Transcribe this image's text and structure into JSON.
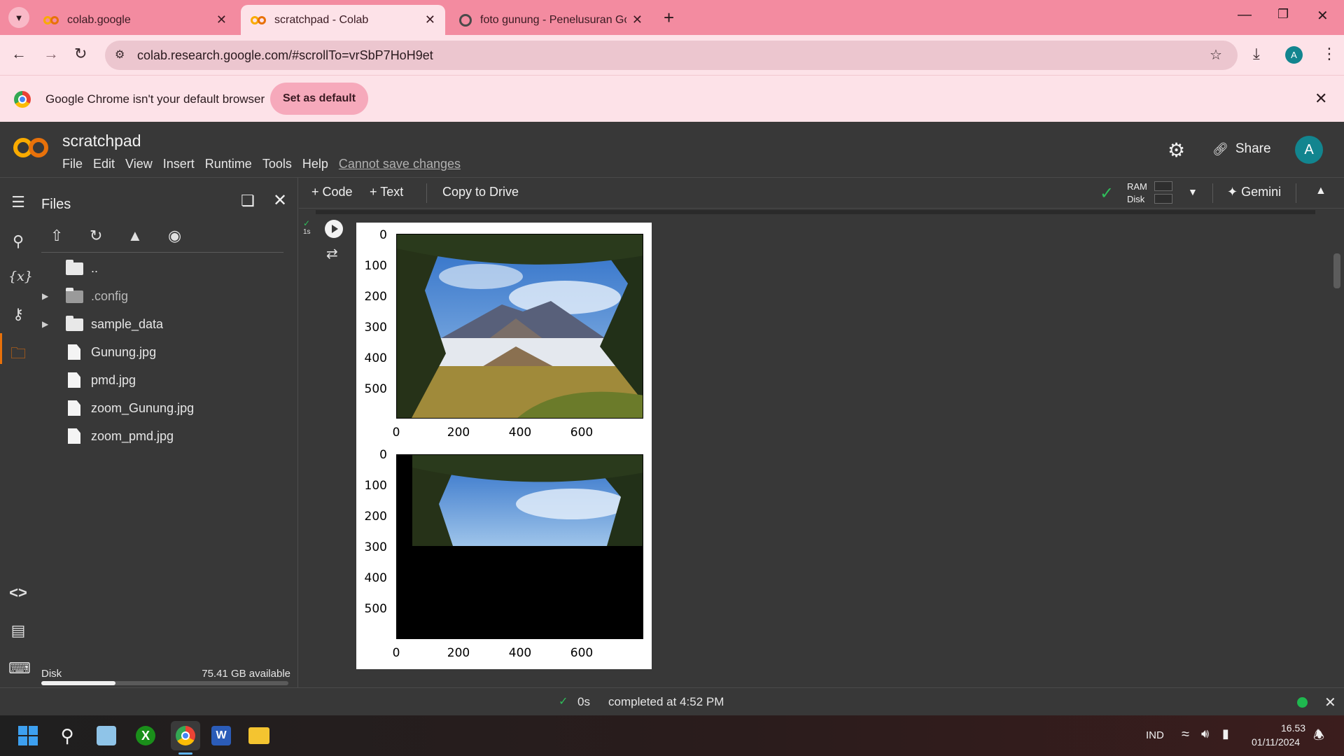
{
  "browser": {
    "tabs": [
      {
        "title": "colab.google",
        "favicon": "colab-icon"
      },
      {
        "title": "scratchpad - Colab",
        "favicon": "colab-icon",
        "active": true
      },
      {
        "title": "foto gunung - Penelusuran Goo",
        "favicon": "google-icon"
      }
    ],
    "url": "colab.research.google.com/#scrollTo=vrSbP7HoH9et",
    "profile_initial": "A",
    "infobar_message": "Google Chrome isn't your default browser",
    "set_default_label": "Set as default"
  },
  "colab": {
    "title": "scratchpad",
    "menu": [
      "File",
      "Edit",
      "View",
      "Insert",
      "Runtime",
      "Tools",
      "Help"
    ],
    "cannot_save": "Cannot save changes",
    "share_label": "Share",
    "avatar_initial": "A",
    "toolbar": {
      "add_code": "+ Code",
      "add_text": "+ Text",
      "copy_to_drive": "Copy to Drive",
      "ram_label": "RAM",
      "disk_label": "Disk",
      "gemini": "Gemini"
    }
  },
  "files_panel": {
    "title": "Files",
    "entries": [
      {
        "name": "..",
        "type": "folder-open"
      },
      {
        "name": ".config",
        "type": "folder",
        "expandable": true
      },
      {
        "name": "sample_data",
        "type": "folder",
        "expandable": true
      },
      {
        "name": "Gunung.jpg",
        "type": "file"
      },
      {
        "name": "pmd.jpg",
        "type": "file"
      },
      {
        "name": "zoom_Gunung.jpg",
        "type": "file"
      },
      {
        "name": "zoom_pmd.jpg",
        "type": "file"
      }
    ],
    "disk_label": "Disk",
    "disk_available": "75.41 GB available",
    "disk_used_fraction": 0.3
  },
  "cell": {
    "exec_time": "1s"
  },
  "output_figure": {
    "yticks": [
      "0",
      "100",
      "200",
      "300",
      "400",
      "500"
    ],
    "xticks": [
      "0",
      "200",
      "400",
      "600"
    ]
  },
  "statusbar": {
    "duration": "0s",
    "message": "completed at 4:52 PM"
  },
  "taskbar": {
    "lang": "IND",
    "time": "16.53",
    "date": "01/11/2024"
  }
}
